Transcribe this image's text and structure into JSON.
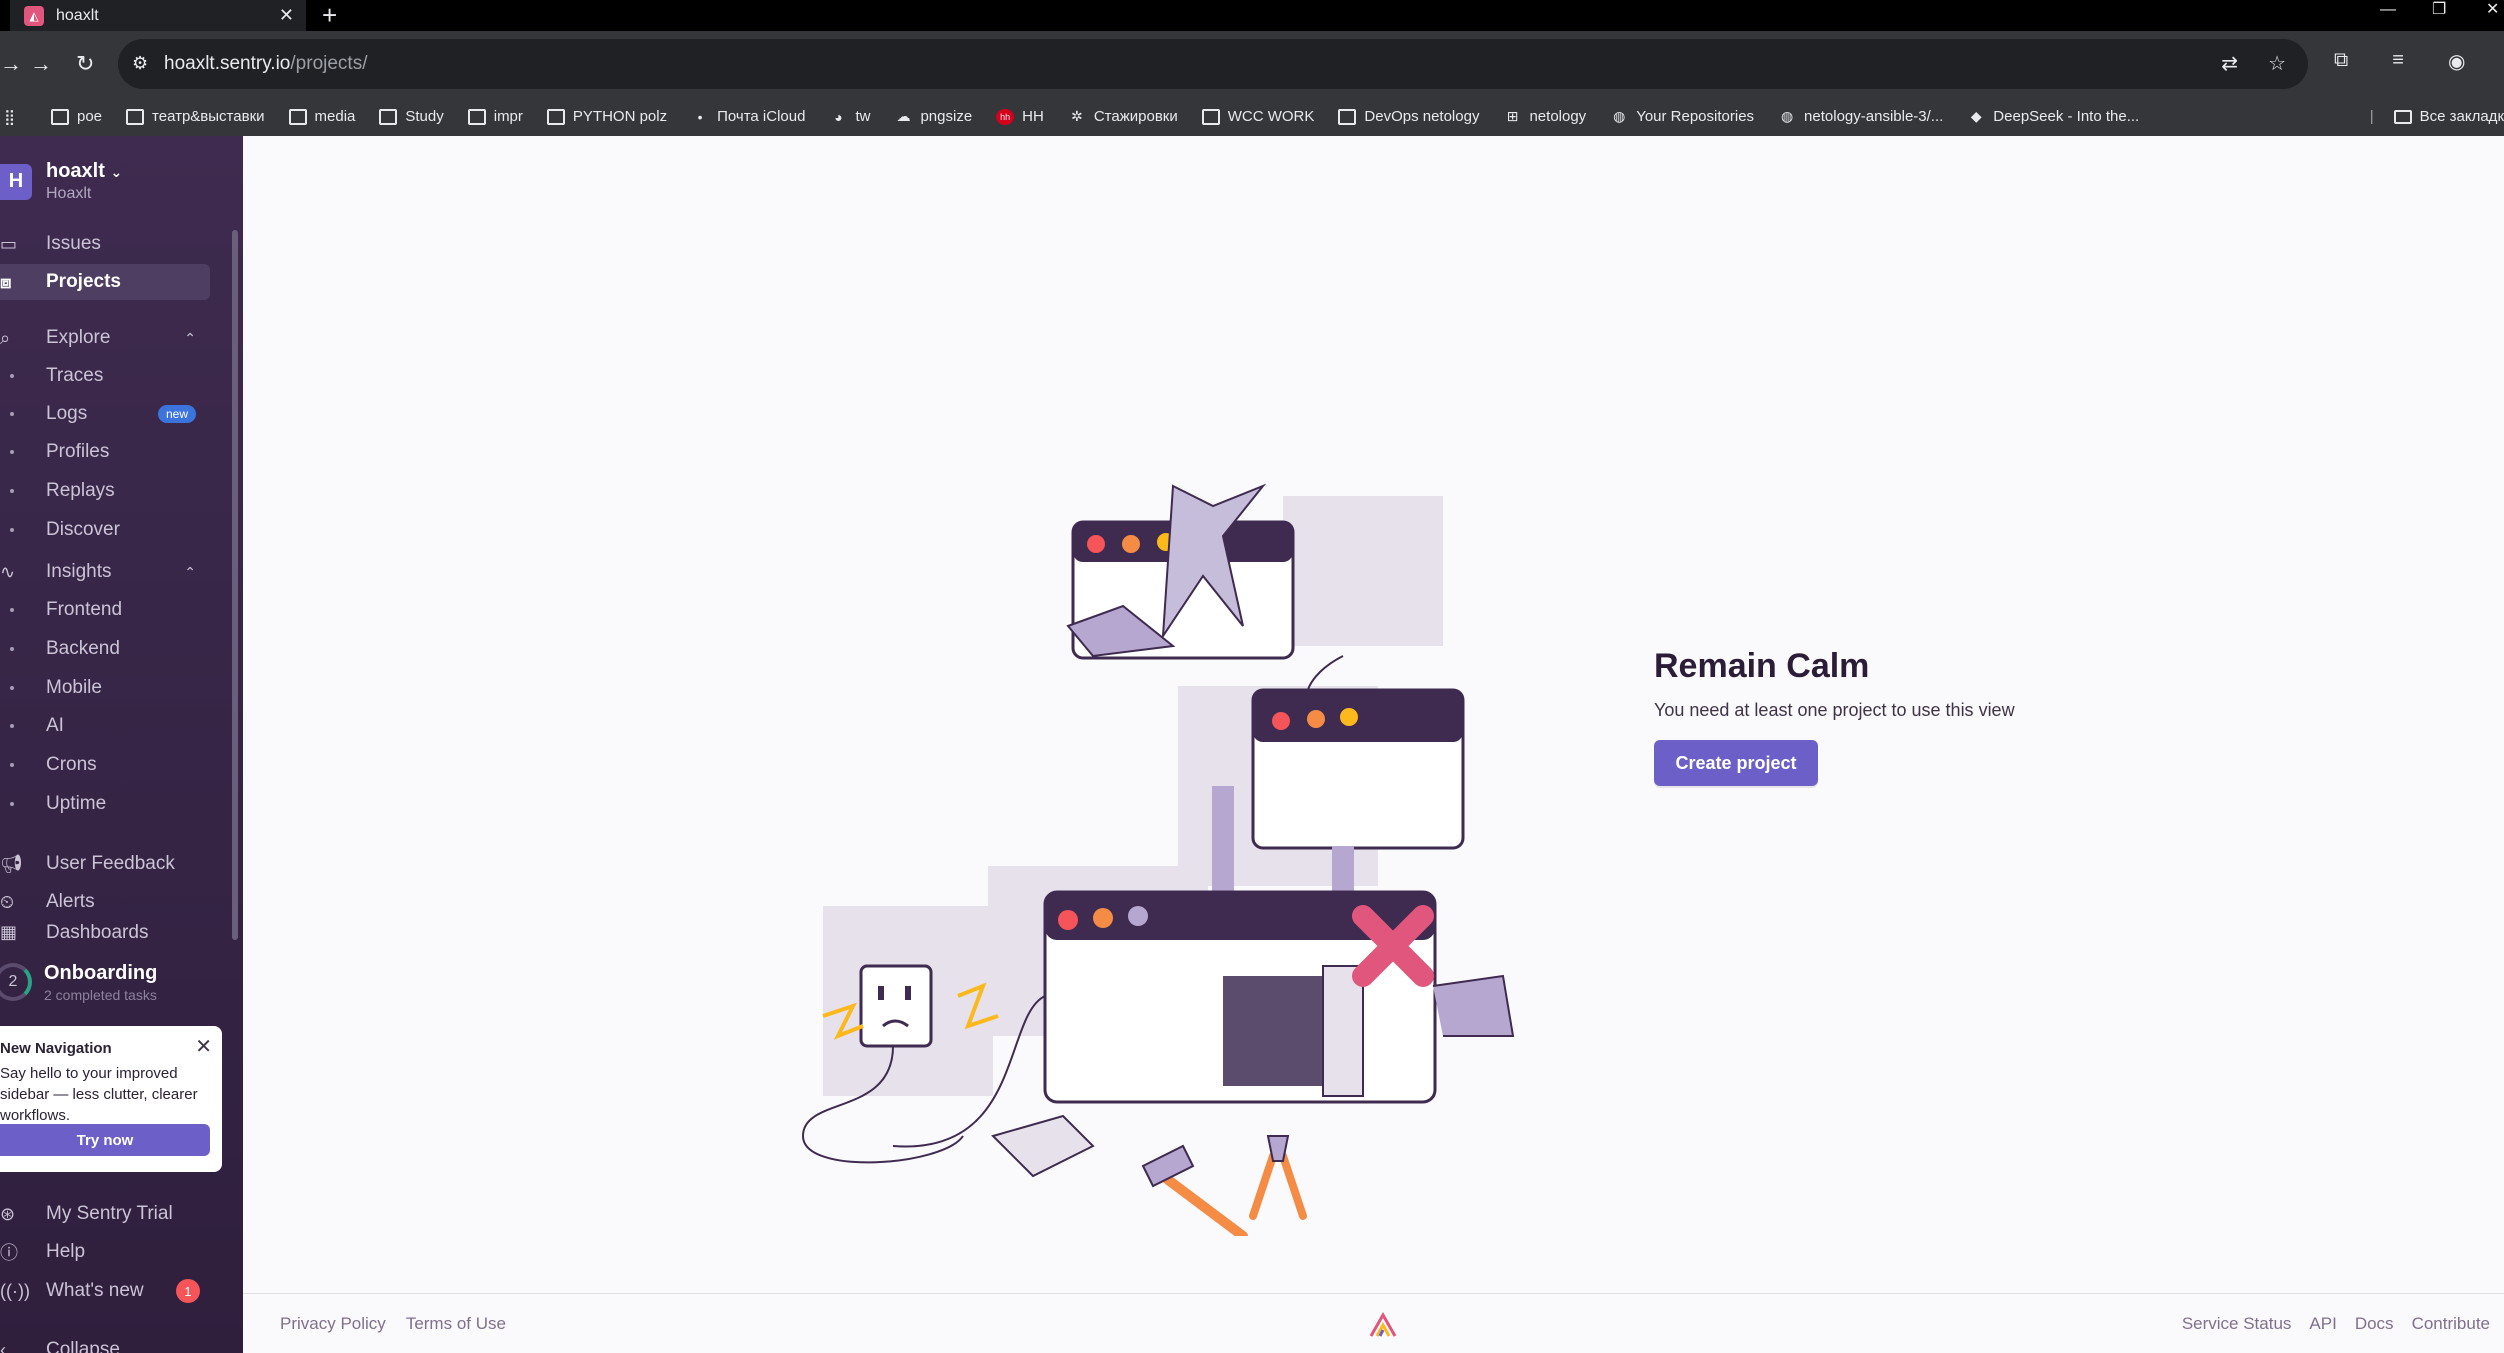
{
  "browser": {
    "tab_title": "hoaxlt",
    "url_host": "hoaxlt.sentry.io",
    "url_path": "/projects/",
    "bookmarks": [
      {
        "label": "poe",
        "icon": "folder-icon"
      },
      {
        "label": "театр&выставки",
        "icon": "folder-icon"
      },
      {
        "label": "media",
        "icon": "folder-icon"
      },
      {
        "label": "Study",
        "icon": "folder-icon"
      },
      {
        "label": "impr",
        "icon": "folder-icon"
      },
      {
        "label": "PYTHON polz",
        "icon": "folder-icon"
      },
      {
        "label": "Почта iCloud",
        "icon": "apple-icon"
      },
      {
        "label": "tw",
        "icon": "tw-icon"
      },
      {
        "label": "pngsize",
        "icon": "pngsize-icon"
      },
      {
        "label": "HH",
        "icon": "hh-icon"
      },
      {
        "label": "Стажировки",
        "icon": "star-icon"
      },
      {
        "label": "WCC WORK",
        "icon": "folder-icon"
      },
      {
        "label": "DevOps netology",
        "icon": "folder-icon"
      },
      {
        "label": "netology",
        "icon": "netology-icon"
      },
      {
        "label": "Your Repositories",
        "icon": "github-icon"
      },
      {
        "label": "netology-ansible-3/...",
        "icon": "github-icon"
      },
      {
        "label": "DeepSeek - Into the...",
        "icon": "deepseek-icon"
      }
    ],
    "all_bookmarks": "Все закладк"
  },
  "sidebar": {
    "org_initial": "H",
    "org_name": "hoaxlt",
    "org_sub": "Hoaxlt",
    "issues": "Issues",
    "projects": "Projects",
    "explore": "Explore",
    "explore_items": [
      "Traces",
      "Logs",
      "Profiles",
      "Replays",
      "Discover"
    ],
    "logs_badge": "new",
    "insights": "Insights",
    "insights_items": [
      "Frontend",
      "Backend",
      "Mobile",
      "AI",
      "Crons",
      "Uptime"
    ],
    "user_feedback": "User Feedback",
    "alerts": "Alerts",
    "dashboards": "Dashboards",
    "onboarding_count": "2",
    "onboarding_title": "Onboarding",
    "onboarding_sub": "2 completed tasks",
    "newnav_title": "New Navigation",
    "newnav_body": "Say hello to your improved sidebar — less clutter, clearer workflows.",
    "try_now": "Try now",
    "trial": "My Sentry Trial",
    "help": "Help",
    "whats_new": "What's new",
    "whats_new_count": "1",
    "collapse": "Collapse"
  },
  "main": {
    "title": "Remain Calm",
    "description": "You need at least one project to use this view",
    "create_button": "Create project"
  },
  "footer": {
    "privacy": "Privacy Policy",
    "terms": "Terms of Use",
    "service_status": "Service Status",
    "api": "API",
    "docs": "Docs",
    "contribute": "Contribute"
  },
  "colors": {
    "accent": "#6c5fc7",
    "sidebar_bg": "#3e2b4f",
    "badge_red": "#f55459",
    "badge_blue": "#3c74dd"
  }
}
